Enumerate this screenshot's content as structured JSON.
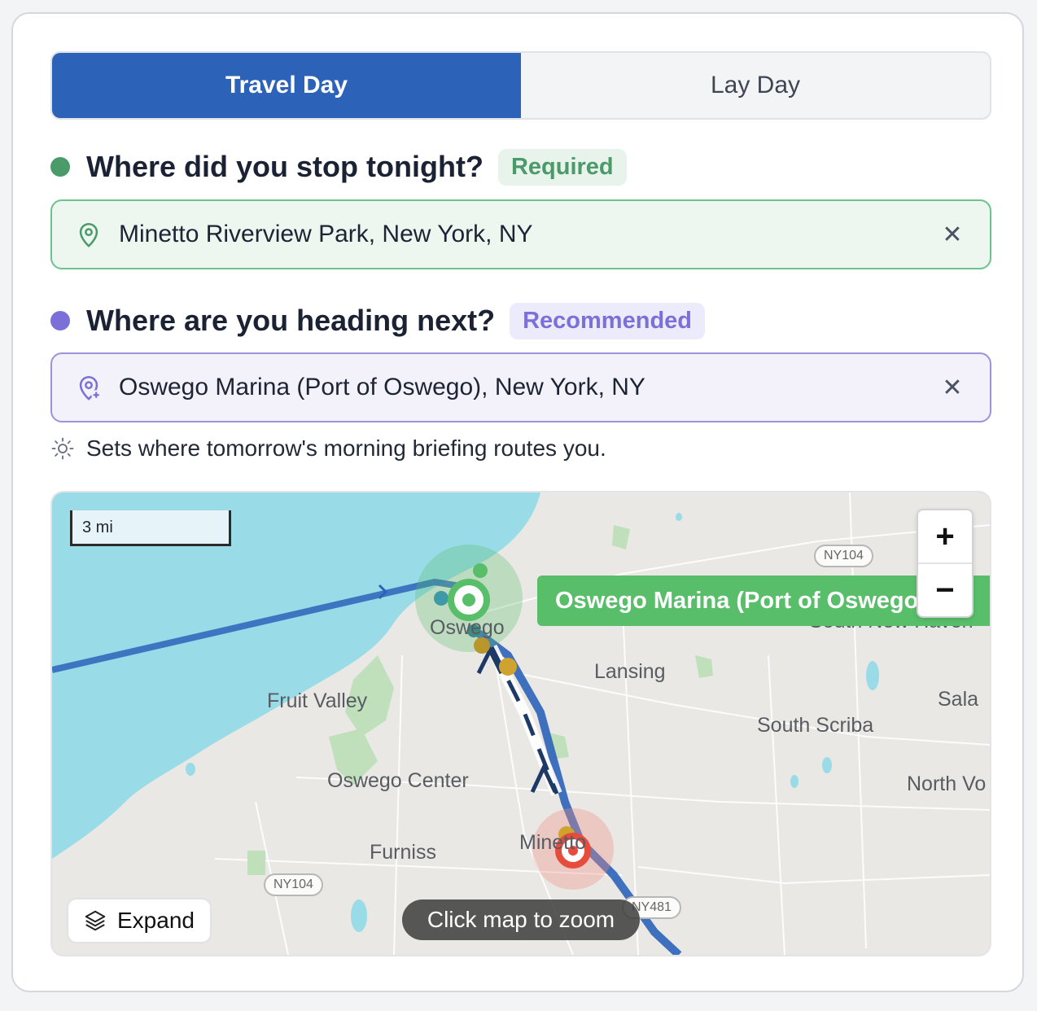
{
  "mode_toggle": {
    "travel_day": "Travel Day",
    "lay_day": "Lay Day",
    "active": "travel_day"
  },
  "stop_section": {
    "title": "Where did you stop tonight?",
    "badge": "Required",
    "dot_color": "#4a9a6a",
    "value": "Minetto Riverview Park, New York, NY",
    "clear_icon": "close-icon",
    "field_icon": "map-pin-icon"
  },
  "next_section": {
    "title": "Where are you heading next?",
    "badge": "Recommended",
    "dot_color": "#7b70d8",
    "value": "Oswego Marina (Port of Oswego), New York, NY",
    "clear_icon": "close-icon",
    "field_icon": "map-pin-plus-icon"
  },
  "hint": {
    "icon": "sun-icon",
    "text": "Sets where tomorrow's morning briefing routes you."
  },
  "map": {
    "scale_label": "3 mi",
    "zoom_in": "+",
    "zoom_out": "−",
    "callout": "Oswego Marina (Port of Oswego), New York, NY",
    "callout_visible": "Oswego Marina (Port of Oswego)",
    "expand_label": "Expand",
    "click_zoom_label": "Click map to zoom",
    "places": {
      "oswego": "Oswego",
      "lansing": "Lansing",
      "fruit_valley": "Fruit Valley",
      "south_scriba": "South Scriba",
      "sala": "Sala",
      "oswego_center": "Oswego Center",
      "north_vo": "North Vo",
      "furniss": "Furniss",
      "minetto": "Minetto",
      "south_new_haven": "South New Haven"
    },
    "shields": {
      "ny104_top": "NY104",
      "ny104_bottom": "NY104",
      "ny481": "NY481"
    },
    "colors": {
      "water": "#9adbe8",
      "route": "#2c63b8",
      "destination": "#58be6a",
      "origin": "#e64b3c"
    }
  }
}
